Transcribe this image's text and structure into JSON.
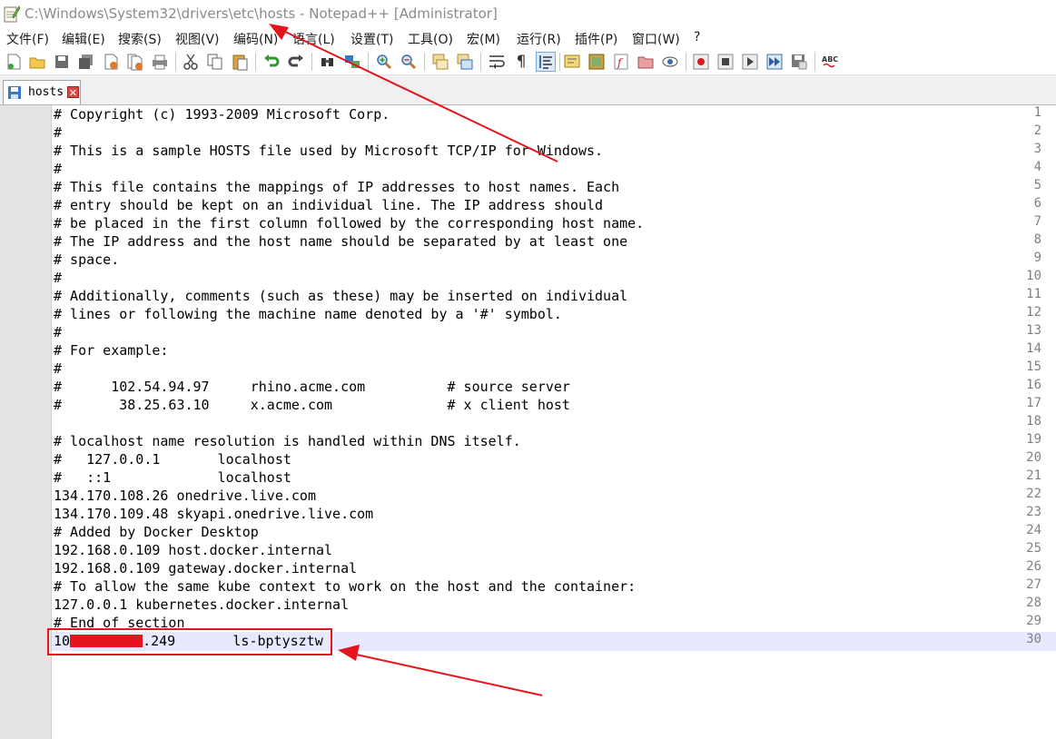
{
  "window": {
    "title": "C:\\Windows\\System32\\drivers\\etc\\hosts - Notepad++ [Administrator]"
  },
  "menu": [
    "文件(F)",
    "编辑(E)",
    "搜索(S)",
    "视图(V)",
    "编码(N)",
    "语言(L)",
    "设置(T)",
    "工具(O)",
    "宏(M)",
    "运行(R)",
    "插件(P)",
    "窗口(W)",
    "?"
  ],
  "toolbar_icons": [
    "new-file-icon",
    "open-file-icon",
    "save-icon",
    "save-all-icon",
    "close-icon",
    "close-all-icon",
    "print-icon",
    "cut-icon",
    "copy-icon",
    "paste-icon",
    "undo-icon",
    "redo-icon",
    "find-icon",
    "replace-icon",
    "zoom-in-icon",
    "zoom-out-icon",
    "sync-vertical-icon",
    "sync-horizontal-icon",
    "word-wrap-icon",
    "show-all-chars-icon",
    "indent-guide-icon",
    "user-language-icon",
    "document-map-icon",
    "function-list-icon",
    "folder-workspace-icon",
    "monitor-icon",
    "record-macro-icon",
    "stop-macro-icon",
    "play-macro-icon",
    "run-macro-multiple-icon",
    "save-macro-icon",
    "spell-check-icon"
  ],
  "tab": {
    "label": "hosts"
  },
  "editor": {
    "lines": [
      {
        "num": "1",
        "text": "# Copyright (c) 1993-2009 Microsoft Corp."
      },
      {
        "num": "2",
        "text": "#"
      },
      {
        "num": "3",
        "text": "# This is a sample HOSTS file used by Microsoft TCP/IP for Windows."
      },
      {
        "num": "4",
        "text": "#"
      },
      {
        "num": "5",
        "text": "# This file contains the mappings of IP addresses to host names. Each"
      },
      {
        "num": "6",
        "text": "# entry should be kept on an individual line. The IP address should"
      },
      {
        "num": "7",
        "text": "# be placed in the first column followed by the corresponding host name."
      },
      {
        "num": "8",
        "text": "# The IP address and the host name should be separated by at least one"
      },
      {
        "num": "9",
        "text": "# space."
      },
      {
        "num": "10",
        "text": "#"
      },
      {
        "num": "11",
        "text": "# Additionally, comments (such as these) may be inserted on individual"
      },
      {
        "num": "12",
        "text": "# lines or following the machine name denoted by a '#' symbol."
      },
      {
        "num": "13",
        "text": "#"
      },
      {
        "num": "14",
        "text": "# For example:"
      },
      {
        "num": "15",
        "text": "#"
      },
      {
        "num": "16",
        "text": "#      102.54.94.97     rhino.acme.com          # source server"
      },
      {
        "num": "17",
        "text": "#       38.25.63.10     x.acme.com              # x client host"
      },
      {
        "num": "18",
        "text": ""
      },
      {
        "num": "19",
        "text": "# localhost name resolution is handled within DNS itself."
      },
      {
        "num": "20",
        "text": "#   127.0.0.1       localhost"
      },
      {
        "num": "21",
        "text": "#   ::1             localhost"
      },
      {
        "num": "22",
        "text": "134.170.108.26 onedrive.live.com"
      },
      {
        "num": "23",
        "text": "134.170.109.48 skyapi.onedrive.live.com"
      },
      {
        "num": "24",
        "text": "# Added by Docker Desktop"
      },
      {
        "num": "25",
        "text": "192.168.0.109 host.docker.internal"
      },
      {
        "num": "26",
        "text": "192.168.0.109 gateway.docker.internal"
      },
      {
        "num": "27",
        "text": "# To allow the same kube context to work on the host and the container:"
      },
      {
        "num": "28",
        "text": "127.0.0.1 kubernetes.docker.internal"
      },
      {
        "num": "29",
        "text": "# End of section"
      }
    ],
    "last_line": {
      "num": "30",
      "ip_prefix": "10",
      "ip_suffix": ".249",
      "host": "       ls-bptysztw"
    },
    "current_line": 30
  },
  "colors": {
    "annotation_red": "#e6141c",
    "gutter_bg": "#e4e4e4",
    "current_line_bg": "#e8e8ff"
  }
}
